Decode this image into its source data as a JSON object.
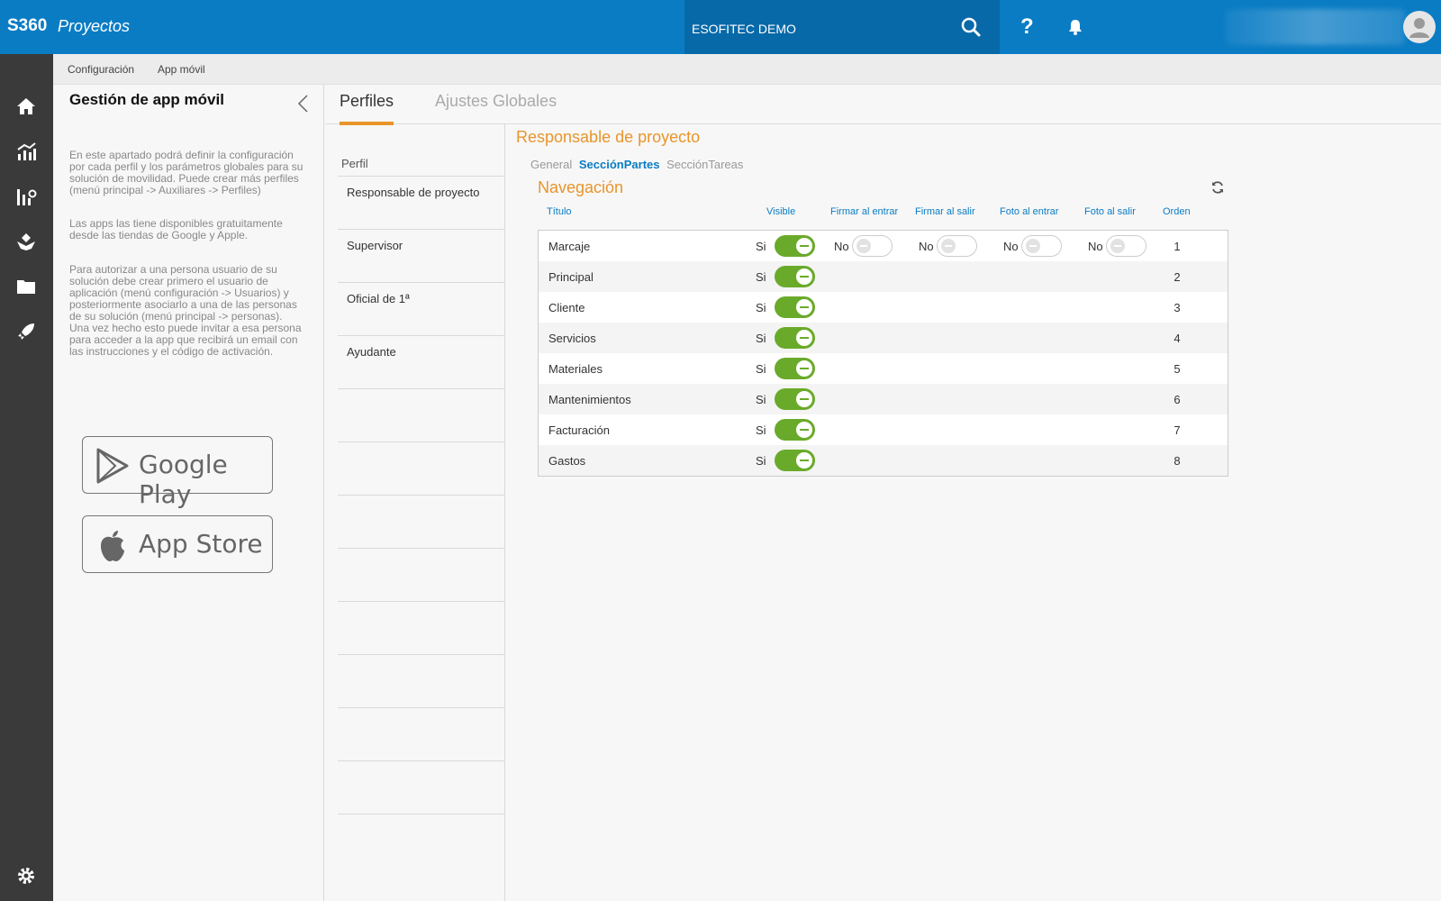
{
  "header": {
    "brand": "S360",
    "app_name": "Proyectos",
    "company": "ESOFITEC DEMO",
    "help": "?"
  },
  "menu": [
    "Configuración",
    "App móvil"
  ],
  "info_panel": {
    "title": "Gestión de app móvil",
    "paragraphs": [
      "En este apartado podrá definir la configuración por cada perfil y los parámetros globales para su solución de movilidad. Puede crear más perfiles (menú principal -> Auxiliares -> Perfiles)",
      "Las apps las tiene disponibles gratuitamente desde las tiendas de Google y Apple.",
      "Para autorizar a una persona usuario de su solución debe crear primero el usuario de aplicación (menú configuración -> Usuarios) y posteriormente asociarlo a una de las personas de su solución (menú principal -> personas). Una vez hecho esto puede invitar a esa persona para acceder a la app que recibirá un email con las instrucciones y el código de activación."
    ],
    "google_play": "Google Play",
    "app_store": "App Store"
  },
  "tabs": [
    {
      "label": "Perfiles",
      "active": true
    },
    {
      "label": "Ajustes Globales",
      "active": false
    }
  ],
  "profiles": {
    "header": "Perfil",
    "items": [
      "Responsable de proyecto",
      "Supervisor",
      "Oficial de 1ª",
      "Ayudante"
    ]
  },
  "main": {
    "profile_title": "Responsable de proyecto",
    "section_tabs": [
      {
        "label": "General",
        "active": false
      },
      {
        "label": "SecciónPartes",
        "active": true
      },
      {
        "label": "SecciónTareas",
        "active": false
      }
    ],
    "nav_title": "Navegación",
    "columns": {
      "titulo": "Título",
      "visible": "Visible",
      "firmar_entrar": "Firmar al entrar",
      "firmar_salir": "Firmar al salir",
      "foto_entrar": "Foto al entrar",
      "foto_salir": "Foto al salir",
      "orden": "Orden"
    },
    "si_label": "Si",
    "no_label": "No",
    "rows": [
      {
        "title": "Marcaje",
        "order": "1"
      },
      {
        "title": "Principal",
        "order": "2"
      },
      {
        "title": "Cliente",
        "order": "3"
      },
      {
        "title": "Servicios",
        "order": "4"
      },
      {
        "title": "Materiales",
        "order": "5"
      },
      {
        "title": "Mantenimientos",
        "order": "6"
      },
      {
        "title": "Facturación",
        "order": "7"
      },
      {
        "title": "Gastos",
        "order": "8"
      }
    ]
  },
  "colors": {
    "primary": "#0a7cc4",
    "accent": "#e8952b",
    "toggle_on": "#6aaa2a",
    "sidebar": "#3a3a3a"
  }
}
